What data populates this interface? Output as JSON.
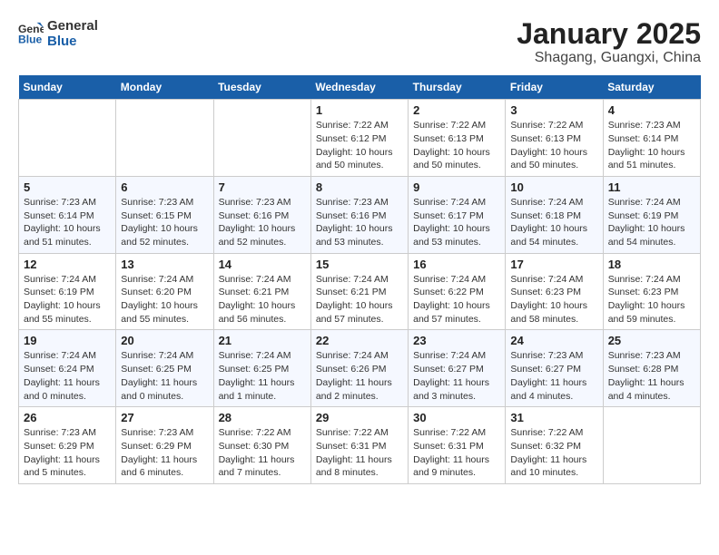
{
  "header": {
    "logo_line1": "General",
    "logo_line2": "Blue",
    "month": "January 2025",
    "location": "Shagang, Guangxi, China"
  },
  "weekdays": [
    "Sunday",
    "Monday",
    "Tuesday",
    "Wednesday",
    "Thursday",
    "Friday",
    "Saturday"
  ],
  "weeks": [
    [
      {
        "day": "",
        "info": ""
      },
      {
        "day": "",
        "info": ""
      },
      {
        "day": "",
        "info": ""
      },
      {
        "day": "1",
        "info": "Sunrise: 7:22 AM\nSunset: 6:12 PM\nDaylight: 10 hours\nand 50 minutes."
      },
      {
        "day": "2",
        "info": "Sunrise: 7:22 AM\nSunset: 6:13 PM\nDaylight: 10 hours\nand 50 minutes."
      },
      {
        "day": "3",
        "info": "Sunrise: 7:22 AM\nSunset: 6:13 PM\nDaylight: 10 hours\nand 50 minutes."
      },
      {
        "day": "4",
        "info": "Sunrise: 7:23 AM\nSunset: 6:14 PM\nDaylight: 10 hours\nand 51 minutes."
      }
    ],
    [
      {
        "day": "5",
        "info": "Sunrise: 7:23 AM\nSunset: 6:14 PM\nDaylight: 10 hours\nand 51 minutes."
      },
      {
        "day": "6",
        "info": "Sunrise: 7:23 AM\nSunset: 6:15 PM\nDaylight: 10 hours\nand 52 minutes."
      },
      {
        "day": "7",
        "info": "Sunrise: 7:23 AM\nSunset: 6:16 PM\nDaylight: 10 hours\nand 52 minutes."
      },
      {
        "day": "8",
        "info": "Sunrise: 7:23 AM\nSunset: 6:16 PM\nDaylight: 10 hours\nand 53 minutes."
      },
      {
        "day": "9",
        "info": "Sunrise: 7:24 AM\nSunset: 6:17 PM\nDaylight: 10 hours\nand 53 minutes."
      },
      {
        "day": "10",
        "info": "Sunrise: 7:24 AM\nSunset: 6:18 PM\nDaylight: 10 hours\nand 54 minutes."
      },
      {
        "day": "11",
        "info": "Sunrise: 7:24 AM\nSunset: 6:19 PM\nDaylight: 10 hours\nand 54 minutes."
      }
    ],
    [
      {
        "day": "12",
        "info": "Sunrise: 7:24 AM\nSunset: 6:19 PM\nDaylight: 10 hours\nand 55 minutes."
      },
      {
        "day": "13",
        "info": "Sunrise: 7:24 AM\nSunset: 6:20 PM\nDaylight: 10 hours\nand 55 minutes."
      },
      {
        "day": "14",
        "info": "Sunrise: 7:24 AM\nSunset: 6:21 PM\nDaylight: 10 hours\nand 56 minutes."
      },
      {
        "day": "15",
        "info": "Sunrise: 7:24 AM\nSunset: 6:21 PM\nDaylight: 10 hours\nand 57 minutes."
      },
      {
        "day": "16",
        "info": "Sunrise: 7:24 AM\nSunset: 6:22 PM\nDaylight: 10 hours\nand 57 minutes."
      },
      {
        "day": "17",
        "info": "Sunrise: 7:24 AM\nSunset: 6:23 PM\nDaylight: 10 hours\nand 58 minutes."
      },
      {
        "day": "18",
        "info": "Sunrise: 7:24 AM\nSunset: 6:23 PM\nDaylight: 10 hours\nand 59 minutes."
      }
    ],
    [
      {
        "day": "19",
        "info": "Sunrise: 7:24 AM\nSunset: 6:24 PM\nDaylight: 11 hours\nand 0 minutes."
      },
      {
        "day": "20",
        "info": "Sunrise: 7:24 AM\nSunset: 6:25 PM\nDaylight: 11 hours\nand 0 minutes."
      },
      {
        "day": "21",
        "info": "Sunrise: 7:24 AM\nSunset: 6:25 PM\nDaylight: 11 hours\nand 1 minute."
      },
      {
        "day": "22",
        "info": "Sunrise: 7:24 AM\nSunset: 6:26 PM\nDaylight: 11 hours\nand 2 minutes."
      },
      {
        "day": "23",
        "info": "Sunrise: 7:24 AM\nSunset: 6:27 PM\nDaylight: 11 hours\nand 3 minutes."
      },
      {
        "day": "24",
        "info": "Sunrise: 7:23 AM\nSunset: 6:27 PM\nDaylight: 11 hours\nand 4 minutes."
      },
      {
        "day": "25",
        "info": "Sunrise: 7:23 AM\nSunset: 6:28 PM\nDaylight: 11 hours\nand 4 minutes."
      }
    ],
    [
      {
        "day": "26",
        "info": "Sunrise: 7:23 AM\nSunset: 6:29 PM\nDaylight: 11 hours\nand 5 minutes."
      },
      {
        "day": "27",
        "info": "Sunrise: 7:23 AM\nSunset: 6:29 PM\nDaylight: 11 hours\nand 6 minutes."
      },
      {
        "day": "28",
        "info": "Sunrise: 7:22 AM\nSunset: 6:30 PM\nDaylight: 11 hours\nand 7 minutes."
      },
      {
        "day": "29",
        "info": "Sunrise: 7:22 AM\nSunset: 6:31 PM\nDaylight: 11 hours\nand 8 minutes."
      },
      {
        "day": "30",
        "info": "Sunrise: 7:22 AM\nSunset: 6:31 PM\nDaylight: 11 hours\nand 9 minutes."
      },
      {
        "day": "31",
        "info": "Sunrise: 7:22 AM\nSunset: 6:32 PM\nDaylight: 11 hours\nand 10 minutes."
      },
      {
        "day": "",
        "info": ""
      }
    ]
  ]
}
